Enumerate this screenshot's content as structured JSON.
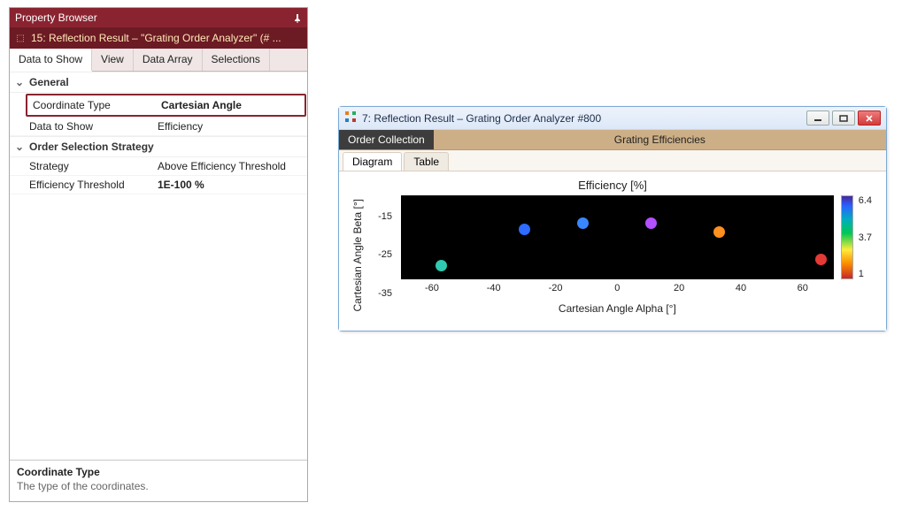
{
  "prop_panel": {
    "title": "Property Browser",
    "subtitle": "15: Reflection Result – \"Grating Order Analyzer\" (# ...",
    "tabs": [
      "Data to Show",
      "View",
      "Data Array",
      "Selections"
    ],
    "active_tab": 0,
    "groups": {
      "general": {
        "label": "General",
        "rows": {
          "coord_type": {
            "label": "Coordinate Type",
            "value": "Cartesian Angle"
          },
          "data_to_show": {
            "label": "Data to Show",
            "value": "Efficiency"
          }
        }
      },
      "order_sel": {
        "label": "Order Selection Strategy",
        "rows": {
          "strategy": {
            "label": "Strategy",
            "value": "Above Efficiency Threshold"
          },
          "threshold": {
            "label": "Efficiency Threshold",
            "value": "1E-100 %"
          }
        }
      }
    },
    "description": {
      "title": "Coordinate Type",
      "body": "The type of the coordinates."
    }
  },
  "chart_window": {
    "title": "7: Reflection Result – Grating Order Analyzer #800",
    "toolbar": {
      "left": "Order Collection",
      "right": "Grating Efficiencies"
    },
    "inner_tabs": [
      "Diagram",
      "Table"
    ],
    "inner_active": 0,
    "chart_title": "Efficiency  [%]",
    "ylabel": "Cartesian Angle Beta [°]",
    "xlabel": "Cartesian Angle Alpha [°]"
  },
  "chart_data": {
    "type": "scatter",
    "title": "Efficiency  [%]",
    "xlabel": "Cartesian Angle Alpha [°]",
    "ylabel": "Cartesian Angle Beta [°]",
    "xlim": [
      -70,
      70
    ],
    "ylim": [
      -45,
      -15
    ],
    "xticks": [
      -60,
      -40,
      -20,
      0,
      20,
      40,
      60
    ],
    "yticks": [
      -15,
      -25,
      -35
    ],
    "colorbar": {
      "label": "Efficiency [%]",
      "min": 1,
      "mid": 3.7,
      "max": 6.4
    },
    "points": [
      {
        "x": -57,
        "y": -40,
        "eff": 3.7,
        "color": "#2fcab0"
      },
      {
        "x": -30,
        "y": -27,
        "eff": 5.5,
        "color": "#2e6bff"
      },
      {
        "x": -11,
        "y": -25,
        "eff": 5.8,
        "color": "#3a86ff"
      },
      {
        "x": 11,
        "y": -25,
        "eff": 6.4,
        "color": "#b450ff"
      },
      {
        "x": 33,
        "y": -28,
        "eff": 2.0,
        "color": "#ff8f1f"
      },
      {
        "x": 66,
        "y": -38,
        "eff": 1.0,
        "color": "#e53935"
      }
    ]
  }
}
